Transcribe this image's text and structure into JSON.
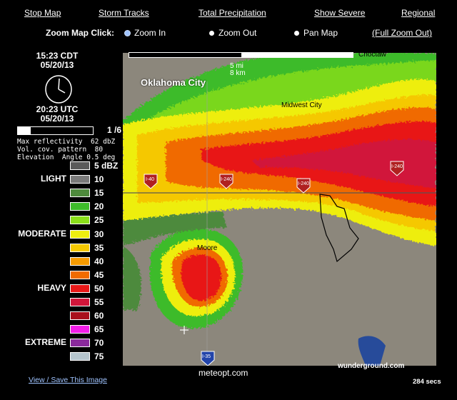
{
  "top_nav": [
    "Stop Map",
    "Storm Tracks",
    "Total Precipitation",
    "Show Severe",
    "Regional"
  ],
  "zoom": {
    "label": "Zoom Map Click:",
    "options": [
      "Zoom In",
      "Zoom Out",
      "Pan Map"
    ],
    "selected": "Zoom In",
    "full_zoom_out": "(Full Zoom Out)"
  },
  "time": {
    "local_time": "15:23 CDT",
    "local_date": "05/20/13",
    "utc_time": "20:23 UTC",
    "utc_date": "05/20/13"
  },
  "frame": {
    "label": "1 /6",
    "progress": 0.17
  },
  "radar_info": {
    "line1": "Max reflectivity  62 dbZ",
    "line2": "Vol. cov. pattern  80",
    "line3": "Elevation  Angle 0.5 deg"
  },
  "legend": {
    "rows": [
      {
        "value": "5 dBZ",
        "color": "#5a5a5a",
        "category": ""
      },
      {
        "value": "10",
        "color": "#7a7a7a",
        "category": "LIGHT"
      },
      {
        "value": "15",
        "color": "#4e8a3c",
        "category": ""
      },
      {
        "value": "20",
        "color": "#3dbb2a",
        "category": ""
      },
      {
        "value": "25",
        "color": "#8adf1a",
        "category": ""
      },
      {
        "value": "30",
        "color": "#eeee10",
        "category": "MODERATE"
      },
      {
        "value": "35",
        "color": "#f5c800",
        "category": ""
      },
      {
        "value": "40",
        "color": "#f59a00",
        "category": ""
      },
      {
        "value": "45",
        "color": "#f06b00",
        "category": ""
      },
      {
        "value": "50",
        "color": "#e81818",
        "category": "HEAVY"
      },
      {
        "value": "55",
        "color": "#d1163a",
        "category": ""
      },
      {
        "value": "60",
        "color": "#a8101c",
        "category": ""
      },
      {
        "value": "65",
        "color": "#f21ee8",
        "category": ""
      },
      {
        "value": "70",
        "color": "#8a2a9c",
        "category": "EXTREME"
      },
      {
        "value": "75",
        "color": "#b4c4cc",
        "category": ""
      }
    ]
  },
  "map": {
    "scale_mi": "5 mi",
    "scale_km": "8 km",
    "cities": [
      "Oklahoma City",
      "Midwest City",
      "Moore"
    ],
    "corner_label": "Choctaw",
    "highways": [
      "I-40",
      "I-240",
      "I-240",
      "I-240",
      "I-35"
    ]
  },
  "footer": {
    "credit": "meteopt.com",
    "view_save": "View / Save This Image",
    "secs": "284 secs",
    "wunderground": "wunderground.com"
  }
}
